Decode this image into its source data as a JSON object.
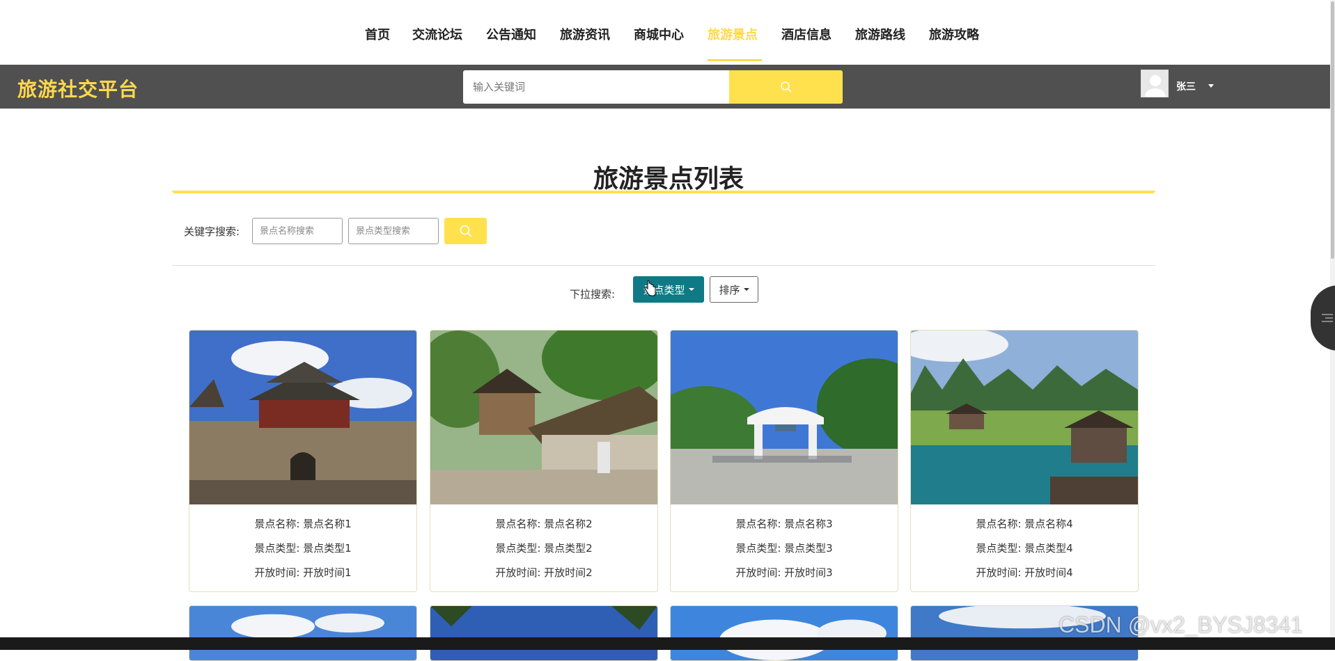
{
  "nav": {
    "items": [
      {
        "label": "首页",
        "active": false
      },
      {
        "label": "交流论坛",
        "active": false
      },
      {
        "label": "公告通知",
        "active": false
      },
      {
        "label": "旅游资讯",
        "active": false
      },
      {
        "label": "商城中心",
        "active": false
      },
      {
        "label": "旅游景点",
        "active": true
      },
      {
        "label": "酒店信息",
        "active": false
      },
      {
        "label": "旅游路线",
        "active": false
      },
      {
        "label": "旅游攻略",
        "active": false
      }
    ]
  },
  "header": {
    "logo": "旅游社交平台",
    "search_placeholder": "输入关键词",
    "username": "张三"
  },
  "page": {
    "title": "旅游景点列表",
    "keyword_label": "关键字搜索:",
    "name_placeholder": "景点名称搜索",
    "type_placeholder": "景点类型搜索",
    "dropdown_label": "下拉搜索:",
    "type_dropdown": "景点类型",
    "sort_dropdown": "排序"
  },
  "cards": [
    {
      "name_label": "景点名称: 景点名称1",
      "type_label": "景点类型: 景点类型1",
      "time_label": "开放时间: 开放时间1"
    },
    {
      "name_label": "景点名称: 景点名称2",
      "type_label": "景点类型: 景点类型2",
      "time_label": "开放时间: 开放时间2"
    },
    {
      "name_label": "景点名称: 景点名称3",
      "type_label": "景点类型: 景点类型3",
      "time_label": "开放时间: 开放时间3"
    },
    {
      "name_label": "景点名称: 景点名称4",
      "type_label": "景点类型: 景点类型4",
      "time_label": "开放时间: 开放时间4"
    }
  ],
  "watermark": "CSDN @vx2_BYSJ8341",
  "colors": {
    "accent": "#ffe14d",
    "header_bar": "#505050",
    "primary_button": "#0f7a86"
  }
}
